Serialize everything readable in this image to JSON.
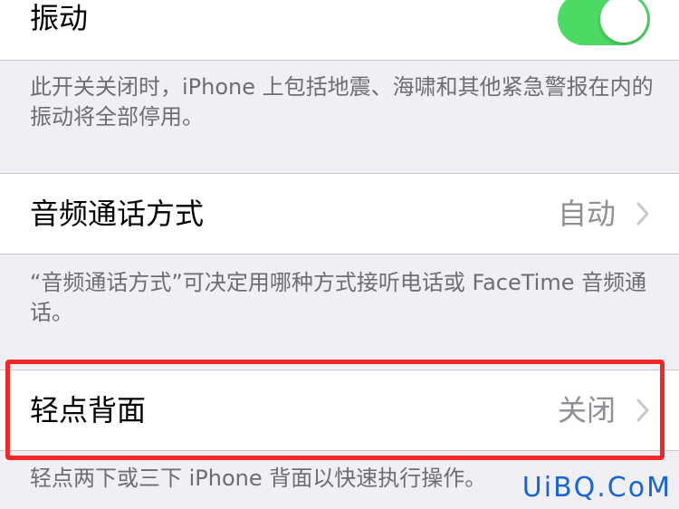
{
  "vibration": {
    "label": "振动",
    "enabled": true,
    "footnote": "此开关关闭时，iPhone 上包括地震、海啸和其他紧急警报在内的振动将全部停用。"
  },
  "call_audio_routing": {
    "label": "音频通话方式",
    "value": "自动",
    "footnote": "“音频通话方式”可决定用哪种方式接听电话或 FaceTime 音频通话。"
  },
  "back_tap": {
    "label": "轻点背面",
    "value": "关闭",
    "footnote": "轻点两下或三下 iPhone 背面以快速执行操作。"
  },
  "watermark": "UiBQ.CoM",
  "colors": {
    "toggle_on": "#4cd964",
    "highlight": "#f32628",
    "watermark": "#1565d8",
    "secondary_text": "#8e8e93"
  }
}
